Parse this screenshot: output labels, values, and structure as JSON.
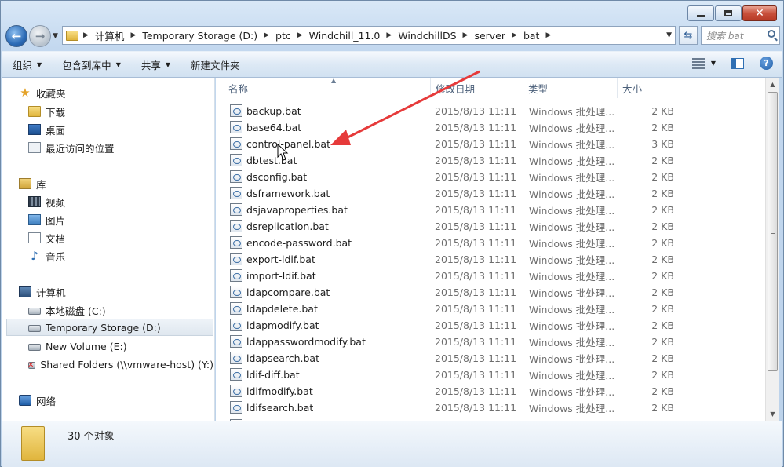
{
  "window": {
    "accent": "#e63a3a"
  },
  "address_bar": {
    "crumbs": [
      "计算机",
      "Temporary Storage (D:)",
      "ptc",
      "Windchill_11.0",
      "WindchillDS",
      "server",
      "bat"
    ]
  },
  "search": {
    "placeholder": "搜索 bat"
  },
  "toolbar": {
    "organize": "组织",
    "include_library": "包含到库中",
    "share": "共享",
    "new_folder": "新建文件夹"
  },
  "navigation": {
    "favorites": "收藏夹",
    "downloads": "下载",
    "desktop": "桌面",
    "recent": "最近访问的位置",
    "libraries": "库",
    "videos": "视频",
    "pictures": "图片",
    "documents": "文档",
    "music": "音乐",
    "computer": "计算机",
    "local_disk": "本地磁盘 (C:)",
    "temp_storage": "Temporary Storage (D:)",
    "new_volume": "New Volume (E:)",
    "shared_folders": "Shared Folders (\\\\vmware-host) (Y:)",
    "network": "网络"
  },
  "columns": {
    "name": "名称",
    "date": "修改日期",
    "type": "类型",
    "size": "大小"
  },
  "files": [
    {
      "name": "backup.bat",
      "date": "2015/8/13 11:11",
      "type": "Windows 批处理...",
      "size": "2 KB"
    },
    {
      "name": "base64.bat",
      "date": "2015/8/13 11:11",
      "type": "Windows 批处理...",
      "size": "2 KB"
    },
    {
      "name": "control-panel.bat",
      "date": "2015/8/13 11:11",
      "type": "Windows 批处理...",
      "size": "3 KB"
    },
    {
      "name": "dbtest.bat",
      "date": "2015/8/13 11:11",
      "type": "Windows 批处理...",
      "size": "2 KB"
    },
    {
      "name": "dsconfig.bat",
      "date": "2015/8/13 11:11",
      "type": "Windows 批处理...",
      "size": "2 KB"
    },
    {
      "name": "dsframework.bat",
      "date": "2015/8/13 11:11",
      "type": "Windows 批处理...",
      "size": "2 KB"
    },
    {
      "name": "dsjavaproperties.bat",
      "date": "2015/8/13 11:11",
      "type": "Windows 批处理...",
      "size": "2 KB"
    },
    {
      "name": "dsreplication.bat",
      "date": "2015/8/13 11:11",
      "type": "Windows 批处理...",
      "size": "2 KB"
    },
    {
      "name": "encode-password.bat",
      "date": "2015/8/13 11:11",
      "type": "Windows 批处理...",
      "size": "2 KB"
    },
    {
      "name": "export-ldif.bat",
      "date": "2015/8/13 11:11",
      "type": "Windows 批处理...",
      "size": "2 KB"
    },
    {
      "name": "import-ldif.bat",
      "date": "2015/8/13 11:11",
      "type": "Windows 批处理...",
      "size": "2 KB"
    },
    {
      "name": "ldapcompare.bat",
      "date": "2015/8/13 11:11",
      "type": "Windows 批处理...",
      "size": "2 KB"
    },
    {
      "name": "ldapdelete.bat",
      "date": "2015/8/13 11:11",
      "type": "Windows 批处理...",
      "size": "2 KB"
    },
    {
      "name": "ldapmodify.bat",
      "date": "2015/8/13 11:11",
      "type": "Windows 批处理...",
      "size": "2 KB"
    },
    {
      "name": "ldappasswordmodify.bat",
      "date": "2015/8/13 11:11",
      "type": "Windows 批处理...",
      "size": "2 KB"
    },
    {
      "name": "ldapsearch.bat",
      "date": "2015/8/13 11:11",
      "type": "Windows 批处理...",
      "size": "2 KB"
    },
    {
      "name": "ldif-diff.bat",
      "date": "2015/8/13 11:11",
      "type": "Windows 批处理...",
      "size": "2 KB"
    },
    {
      "name": "ldifmodify.bat",
      "date": "2015/8/13 11:11",
      "type": "Windows 批处理...",
      "size": "2 KB"
    },
    {
      "name": "ldifsearch.bat",
      "date": "2015/8/13 11:11",
      "type": "Windows 批处理...",
      "size": "2 KB"
    }
  ],
  "status": {
    "item_count": "30 个对象"
  }
}
